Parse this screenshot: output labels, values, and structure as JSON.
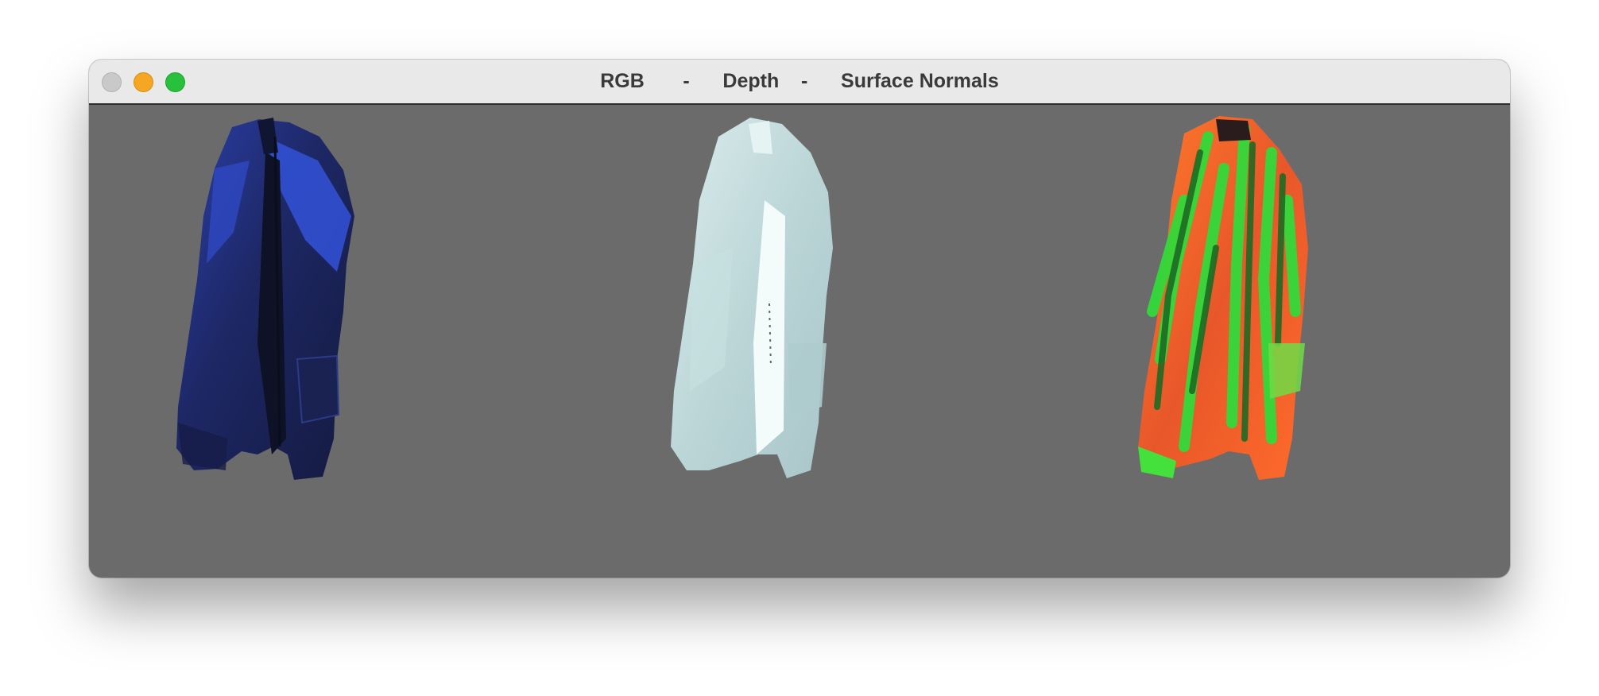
{
  "window": {
    "title": "RGB       -      Depth    -      Surface Normals",
    "controls": [
      "close",
      "minimize",
      "maximize"
    ],
    "background_color": "#6b6b6b"
  },
  "panels": [
    {
      "view": "rgb",
      "subject": "jacket",
      "colors": [
        "#1b2457",
        "#2d48c8",
        "#0f1324"
      ]
    },
    {
      "view": "depth",
      "subject": "jacket",
      "colors": [
        "#cfe3e4",
        "#a9c6c8",
        "#f4fbfb"
      ]
    },
    {
      "view": "surface-normals",
      "subject": "jacket",
      "colors": [
        "#ff6a1f",
        "#35e03a",
        "#1f5a22"
      ]
    }
  ]
}
